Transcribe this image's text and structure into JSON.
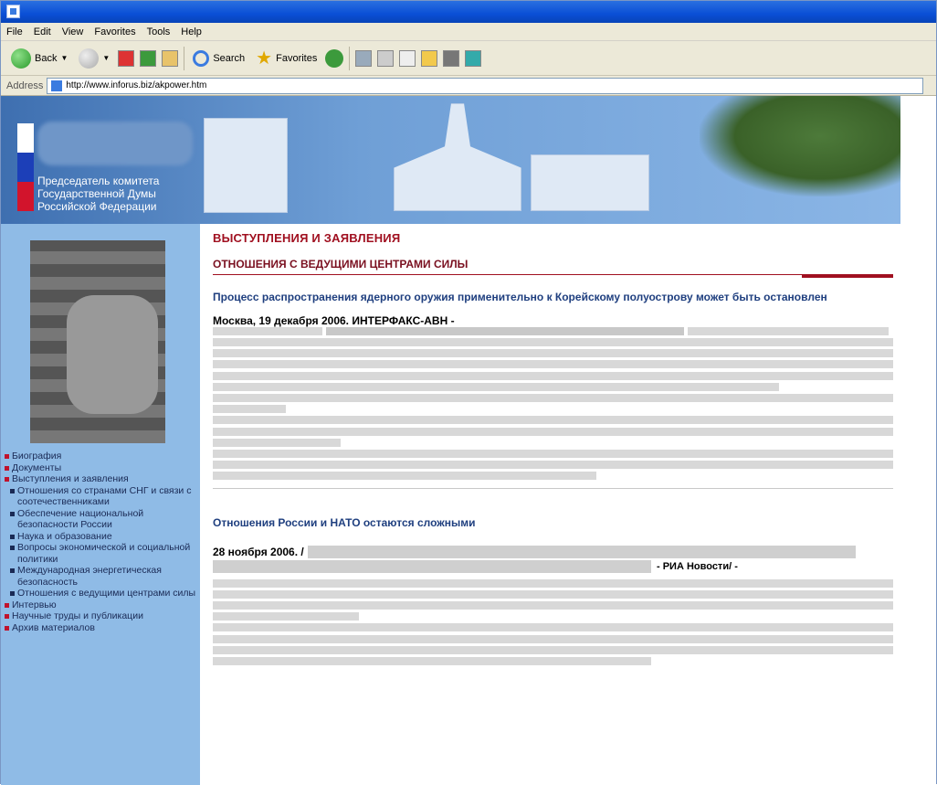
{
  "browser": {
    "menu": [
      "File",
      "Edit",
      "View",
      "Favorites",
      "Tools",
      "Help"
    ],
    "toolbar": {
      "back": "Back",
      "search": "Search",
      "favorites": "Favorites"
    },
    "address_label": "Address",
    "address_url": "http://www.inforus.biz/akpower.htm"
  },
  "header": {
    "committee_lines": [
      "Председатель комитета",
      "Государственной Думы",
      "Российской Федерации"
    ]
  },
  "sidebar": {
    "items": [
      {
        "label": "Биография",
        "type": "item"
      },
      {
        "label": "Документы",
        "type": "item"
      },
      {
        "label": "Выступления и заявления",
        "type": "item"
      },
      {
        "label": "Отношения со странами СНГ и связи с соотечественниками",
        "type": "sub"
      },
      {
        "label": "Обеспечение национальной безопасности России",
        "type": "sub"
      },
      {
        "label": "Наука и образование",
        "type": "sub"
      },
      {
        "label": "Вопросы экономической и социальной политики",
        "type": "sub"
      },
      {
        "label": "Международная энергетическая безопасность",
        "type": "sub"
      },
      {
        "label": "Отношения с ведущими центрами силы",
        "type": "sub"
      },
      {
        "label": "Интервью",
        "type": "item"
      },
      {
        "label": "Научные труды и публикации",
        "type": "item"
      },
      {
        "label": "Архив материалов",
        "type": "item"
      }
    ]
  },
  "main": {
    "heading": "ВЫСТУПЛЕНИЯ И ЗАЯВЛЕНИЯ",
    "section": "ОТНОШЕНИЯ С ВЕДУЩИМИ ЦЕНТРАМИ СИЛЫ",
    "article1": {
      "title": "Процесс распространения ядерного оружия применительно к Корейскому полуострову может быть остановлен",
      "dateline": "Москва, 19 декабря 2006. ИНТЕРФАКС-АВН -"
    },
    "article2": {
      "title": "Отношения России и НАТО остаются сложными",
      "dateline": "28 ноября 2006. /",
      "source": "- РИА Новости/ -"
    }
  },
  "colors": {
    "accent": "#a01020",
    "link": "#1f3f7f",
    "sidebar": "#8fbbe6",
    "banner": "#3e6fb0"
  }
}
